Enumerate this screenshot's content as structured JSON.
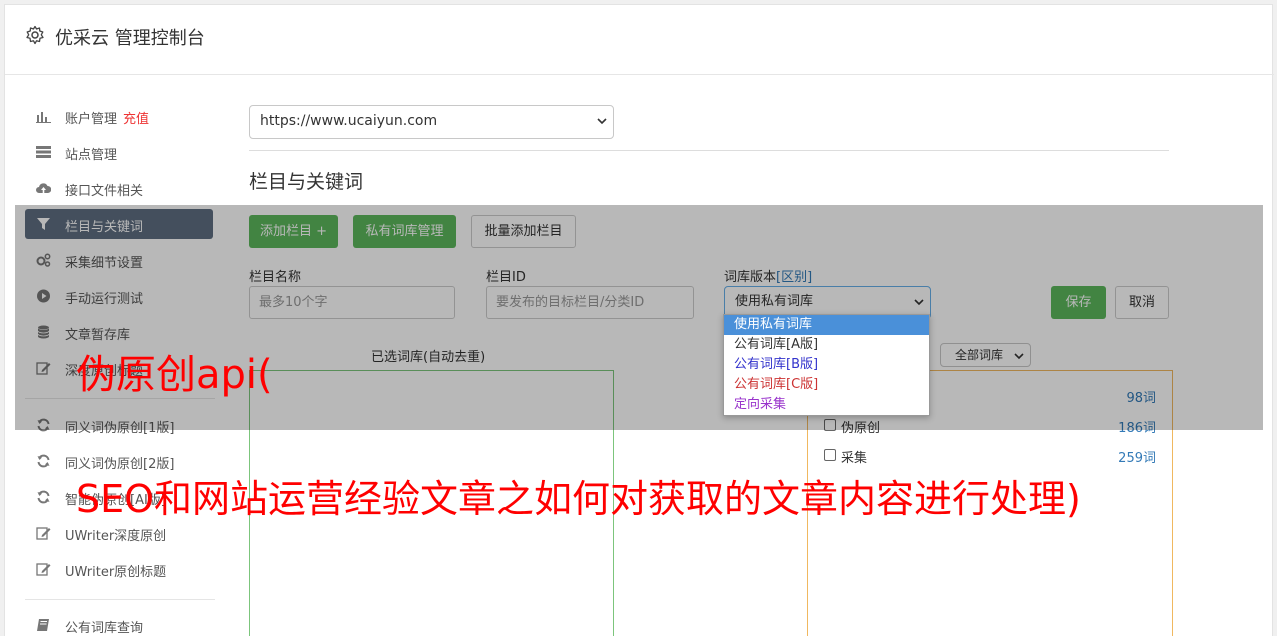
{
  "header": {
    "title": "优采云 管理控制台"
  },
  "sidebar": {
    "items": [
      {
        "label": "账户管理",
        "extra": "充值"
      },
      {
        "label": "站点管理"
      },
      {
        "label": "接口文件相关"
      },
      {
        "label": "栏目与关键词"
      },
      {
        "label": "采集细节设置"
      },
      {
        "label": "手动运行测试"
      },
      {
        "label": "文章暂存库"
      },
      {
        "label": "深度原创标题"
      },
      {
        "label": "同义词伪原创[1版]"
      },
      {
        "label": "同义词伪原创[2版]"
      },
      {
        "label": "智能伪原创[AI版]"
      },
      {
        "label": "UWriter深度原创"
      },
      {
        "label": "UWriter原创标题"
      },
      {
        "label": "公有词库查询"
      }
    ]
  },
  "main": {
    "site_select": "https://www.ucaiyun.com",
    "section_title": "栏目与关键词",
    "buttons": {
      "add": "添加栏目 +",
      "private": "私有词库管理",
      "batch": "批量添加栏目",
      "save": "保存",
      "cancel": "取消"
    },
    "fields": {
      "name_label": "栏目名称",
      "name_placeholder": "最多10个字",
      "id_label": "栏目ID",
      "id_placeholder": "要发布的目标栏目/分类ID",
      "version_label": "词库版本",
      "version_link": "[区别]",
      "version_value": "使用私有词库"
    },
    "version_options": [
      {
        "label": "使用私有词库",
        "color": "#ffffff",
        "bg": "#4a90d9"
      },
      {
        "label": "公有词库[A版]",
        "color": "#333333"
      },
      {
        "label": "公有词库[B版]",
        "color": "#3333cc"
      },
      {
        "label": "公有词库[C版]",
        "color": "#cc3333"
      },
      {
        "label": "定向采集",
        "color": "#9933cc"
      }
    ],
    "selected_label": "已选词库(自动去重)",
    "filter_select": "全部词库",
    "libraries": [
      {
        "name": "",
        "count": "98词"
      },
      {
        "name": "伪原创",
        "count": "186词"
      },
      {
        "name": "采集",
        "count": "259词"
      }
    ]
  },
  "watermark": {
    "line1": "伪原创api(",
    "line2": "SEO和网站运营经验文章之如何对获取的文章内容进行处理)"
  },
  "colors": {
    "active_nav": "#5f6e81",
    "green": "#5cb85c",
    "watermark": "#ff0000"
  }
}
